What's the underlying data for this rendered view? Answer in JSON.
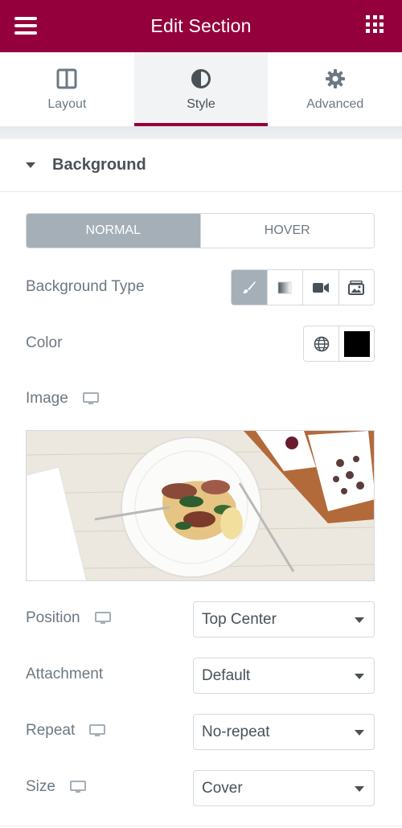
{
  "header": {
    "title": "Edit Section",
    "menu_icon": "hamburger-icon",
    "apps_icon": "grid-icon",
    "bg_color": "#93003c"
  },
  "tabs": [
    {
      "label": "Layout",
      "icon": "columns-icon",
      "active": false
    },
    {
      "label": "Style",
      "icon": "half-circle-icon",
      "active": true
    },
    {
      "label": "Advanced",
      "icon": "gear-icon",
      "active": false
    }
  ],
  "section": {
    "title": "Background"
  },
  "state_switch": {
    "normal": "Normal",
    "hover": "Hover",
    "selected": "normal"
  },
  "background_type": {
    "label": "Background Type",
    "options": [
      "brush-icon",
      "gradient-icon",
      "video-icon",
      "slideshow-icon"
    ],
    "selected": 0
  },
  "color": {
    "label": "Color",
    "value": "#000000"
  },
  "image": {
    "label": "Image"
  },
  "position": {
    "label": "Position",
    "value": "Top Center"
  },
  "attachment": {
    "label": "Attachment",
    "value": "Default"
  },
  "repeat": {
    "label": "Repeat",
    "value": "No-repeat"
  },
  "size": {
    "label": "Size",
    "value": "Cover"
  }
}
